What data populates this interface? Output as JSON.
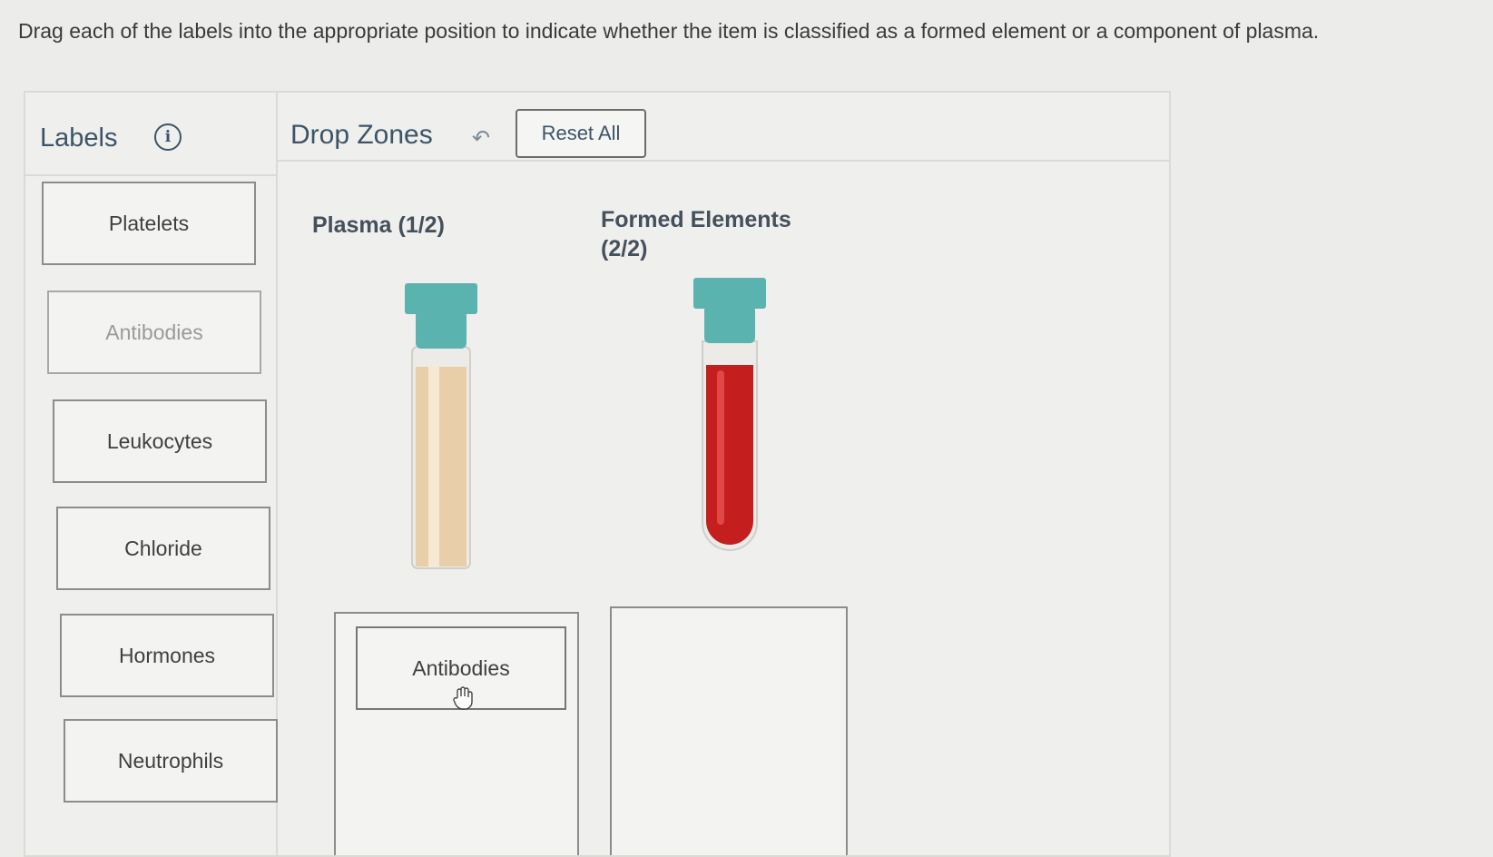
{
  "instructions": "Drag each of the labels into the appropriate position to indicate whether the item is classified as a formed element or a component of plasma.",
  "labels_panel": {
    "title": "Labels",
    "info_icon": "info-icon",
    "items": [
      {
        "label": "Platelets",
        "placed": false
      },
      {
        "label": "Antibodies",
        "placed": true
      },
      {
        "label": "Leukocytes",
        "placed": false
      },
      {
        "label": "Chloride",
        "placed": false
      },
      {
        "label": "Hormones",
        "placed": false
      },
      {
        "label": "Neutrophils",
        "placed": false
      }
    ]
  },
  "drop_panel": {
    "title": "Drop Zones",
    "undo_icon": "undo-icon",
    "reset_label": "Reset All",
    "zones": [
      {
        "title": "Plasma (1/2)",
        "tube_color": "#e8cfa9",
        "placed": [
          "Antibodies"
        ]
      },
      {
        "title": "Formed Elements (2/2)",
        "tube_color": "#c41e1e",
        "placed": []
      }
    ]
  },
  "colors": {
    "accent": "#3d5468",
    "cap": "#5bb3b0",
    "plasma": "#e8cfa9",
    "blood": "#c41e1e"
  }
}
